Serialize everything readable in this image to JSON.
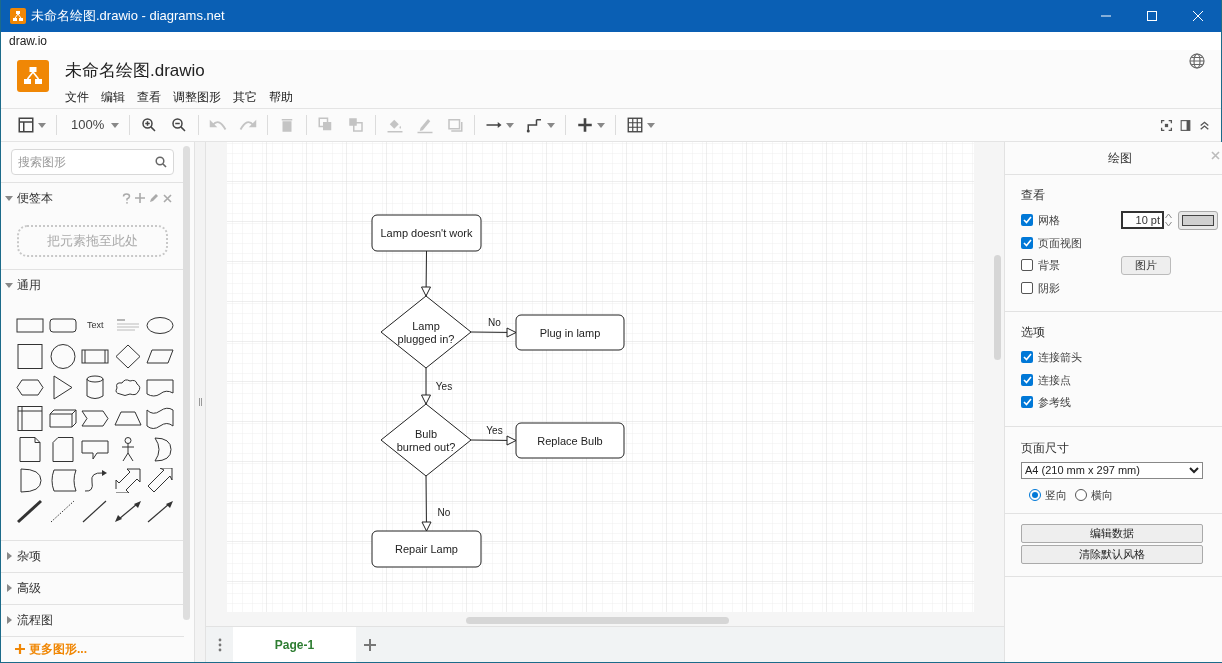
{
  "window": {
    "title": "未命名绘图.drawio - diagrams.net"
  },
  "app_label": "draw.io",
  "document": {
    "title": "未命名绘图.drawio"
  },
  "menu": [
    "文件",
    "编辑",
    "查看",
    "调整图形",
    "其它",
    "帮助"
  ],
  "toolbar": {
    "tool_groups": [
      [
        {
          "kind": "format",
          "disabled": false,
          "dropdown": true
        }
      ],
      [
        {
          "kind": "zoom",
          "label": "100%",
          "disabled": false,
          "dropdown": true
        }
      ],
      [
        {
          "kind": "zoom_in",
          "disabled": false,
          "dropdown": false
        },
        {
          "kind": "zoom_out",
          "disabled": false,
          "dropdown": false
        }
      ],
      [
        {
          "kind": "undo",
          "disabled": true,
          "dropdown": false
        },
        {
          "kind": "redo",
          "disabled": true,
          "dropdown": false
        }
      ],
      [
        {
          "kind": "delete",
          "disabled": true,
          "dropdown": false
        }
      ],
      [
        {
          "kind": "to_front",
          "disabled": true,
          "dropdown": false
        },
        {
          "kind": "to_back",
          "disabled": true,
          "dropdown": false
        }
      ],
      [
        {
          "kind": "fill",
          "disabled": true,
          "dropdown": false
        },
        {
          "kind": "line_color",
          "disabled": true,
          "dropdown": false
        },
        {
          "kind": "shadow",
          "disabled": true,
          "dropdown": false
        }
      ],
      [
        {
          "kind": "connection",
          "disabled": false,
          "dropdown": true
        },
        {
          "kind": "waypoints",
          "disabled": false,
          "dropdown": true
        }
      ],
      [
        {
          "kind": "insert",
          "disabled": false,
          "dropdown": true
        }
      ],
      [
        {
          "kind": "table",
          "disabled": false,
          "dropdown": true
        }
      ]
    ],
    "right_tools": [
      {
        "kind": "fullscreen"
      },
      {
        "kind": "format_panel"
      },
      {
        "kind": "collapse"
      }
    ]
  },
  "sidebar": {
    "search": {
      "placeholder": "搜索图形"
    },
    "sections": [
      {
        "kind": "scratchpad",
        "title": "便签本",
        "expanded": true,
        "drop_hint": "把元素拖至此处"
      },
      {
        "kind": "shapes",
        "title": "通用",
        "expanded": true,
        "text_shape": "Text"
      },
      {
        "kind": "plain",
        "title": "杂项",
        "expanded": false
      },
      {
        "kind": "plain",
        "title": "高级",
        "expanded": false
      },
      {
        "kind": "plain",
        "title": "流程图",
        "expanded": false
      }
    ],
    "more_shapes": "更多图形..."
  },
  "diagram": {
    "nodes": [
      {
        "kind": "process",
        "lines": [
          "Lamp doesn't work"
        ]
      },
      {
        "kind": "decision",
        "lines": [
          "Lamp",
          "plugged in?"
        ]
      },
      {
        "kind": "process",
        "lines": [
          "Plug in lamp"
        ]
      },
      {
        "kind": "decision",
        "lines": [
          "Bulb",
          "burned out?"
        ]
      },
      {
        "kind": "process",
        "lines": [
          "Replace Bulb"
        ]
      },
      {
        "kind": "process",
        "lines": [
          "Repair Lamp"
        ]
      }
    ],
    "edges": [
      {
        "kind": "arrow"
      },
      {
        "kind": "arrow",
        "label": "No"
      },
      {
        "kind": "arrow",
        "label": "Yes"
      },
      {
        "kind": "arrow",
        "label": "Yes"
      },
      {
        "kind": "arrow",
        "label": "No"
      }
    ]
  },
  "pages": [
    {
      "label": "Page-1",
      "selected": true
    }
  ],
  "format_panel": {
    "title": "绘图",
    "view": {
      "title": "查看",
      "options": [
        {
          "label": "网格",
          "checked": true
        },
        {
          "label": "页面视图",
          "checked": true
        },
        {
          "label": "背景",
          "checked": false
        },
        {
          "label": "阴影",
          "checked": false
        }
      ],
      "grid_size": "10 pt",
      "background_button": "图片"
    },
    "options": {
      "title": "选项",
      "options": [
        {
          "label": "连接箭头",
          "checked": true
        },
        {
          "label": "连接点",
          "checked": true
        },
        {
          "label": "参考线",
          "checked": true
        }
      ]
    },
    "page_size": {
      "title": "页面尺寸",
      "value": "A4 (210 mm x 297 mm)",
      "orientations": [
        {
          "label": "竖向",
          "selected": true
        },
        {
          "label": "横向",
          "selected": false
        }
      ]
    },
    "buttons": [
      "编辑数据",
      "清除默认风格"
    ]
  }
}
